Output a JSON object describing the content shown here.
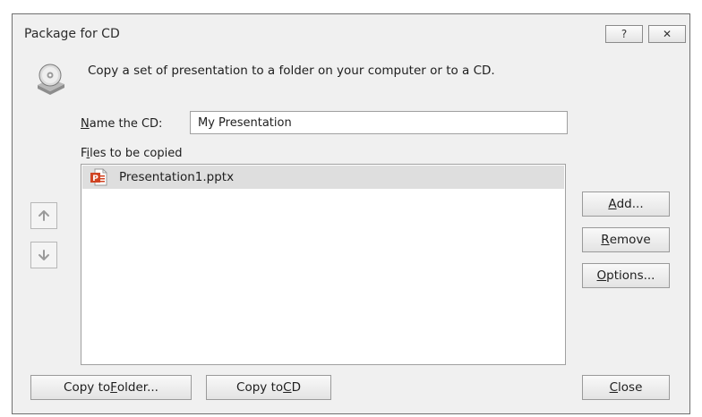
{
  "window": {
    "title": "Package for CD",
    "help_glyph": "?",
    "close_glyph": "✕"
  },
  "description": "Copy a set of presentation to a folder on your computer or to a CD.",
  "name_field": {
    "label_accel": "N",
    "label_rest": "ame the CD:",
    "value": "My Presentation"
  },
  "files": {
    "label_first": "F",
    "label_accel": "i",
    "label_rest": "les to be copied",
    "items": [
      {
        "name": "Presentation1.pptx",
        "icon": "powerpoint-file-icon"
      }
    ]
  },
  "buttons": {
    "add": {
      "accel": "A",
      "rest": "dd..."
    },
    "remove": {
      "accel": "R",
      "rest": "emove"
    },
    "options": {
      "accel": "O",
      "rest": "ptions..."
    },
    "copy_folder": {
      "pre": "Copy to ",
      "accel": "F",
      "rest": "older..."
    },
    "copy_cd": {
      "pre": "Copy to ",
      "accel": "C",
      "rest": "D"
    },
    "close": {
      "accel": "C",
      "rest": "lose"
    }
  },
  "icons": {
    "cd_drive": "cd-drive-icon",
    "move_up": "arrow-up-icon",
    "move_down": "arrow-down-icon"
  },
  "colors": {
    "dialog_bg": "#f0f0f0",
    "selected_row": "#dedede",
    "ppt_orange": "#d04423"
  }
}
